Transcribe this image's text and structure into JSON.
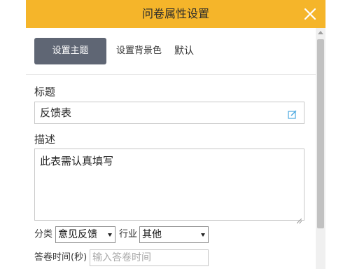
{
  "dialog": {
    "title": "问卷属性设置"
  },
  "tabs": {
    "theme_label": "设置主题",
    "background_label": "设置背景色",
    "default_label": "默认"
  },
  "form": {
    "title_label": "标题",
    "title_value": "反馈表",
    "description_label": "描述",
    "description_value": "此表需认真填写",
    "category_label": "分类",
    "category_selected": "意见反馈",
    "industry_label": "行业",
    "industry_selected": "其他",
    "time_label": "答卷时间(秒)",
    "time_placeholder": "输入答卷时间"
  },
  "colors": {
    "titlebar": "#f5b52a",
    "primary_tab": "#5f6674",
    "edit_icon": "#4aa8e0"
  },
  "icons": {
    "close": "close-icon",
    "edit": "edit-icon",
    "dropdown": "chevron-down-icon"
  }
}
